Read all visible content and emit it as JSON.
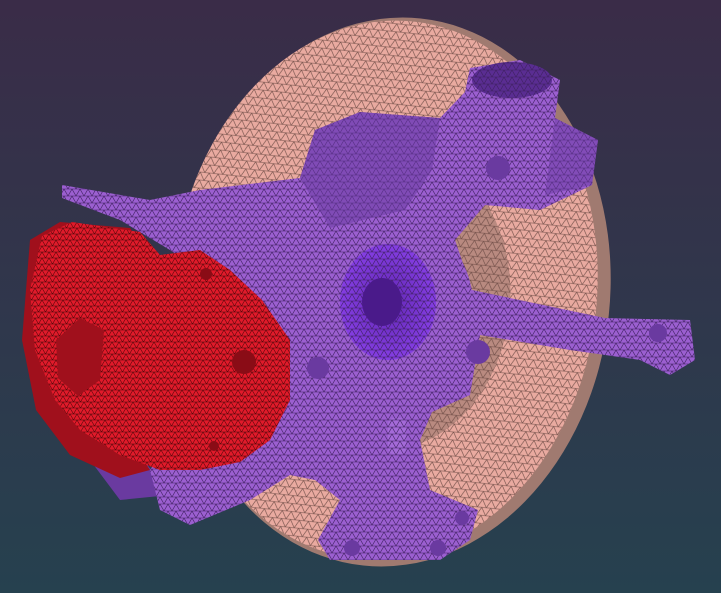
{
  "viewport": {
    "background_top": "#3a2c48",
    "background_bottom": "#26414f"
  },
  "parts": {
    "rotor_color": "#e9aaa0",
    "rotor_edge_color": "#a07a70",
    "hat_color": "#b98a80",
    "knuckle_color": "#9b5fd0",
    "knuckle_dark_color": "#6a3aa0",
    "hub_color": "#7e35dc",
    "caliper_color": "#e01a2a",
    "caliper_dark_color": "#a0101c"
  },
  "mesh": {
    "rotor_line": "#6b4a44",
    "knuckle_line": "#3e2060",
    "caliper_line": "#4a0608"
  }
}
